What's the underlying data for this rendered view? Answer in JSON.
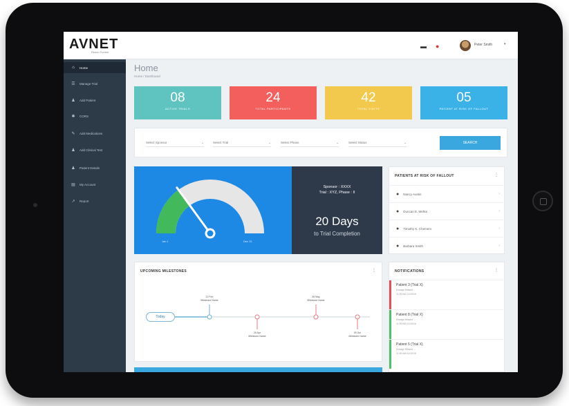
{
  "app": {
    "logo": "AVNET",
    "logo_sub": "Reach Further"
  },
  "topbar": {
    "menu_icon": "menu-icon",
    "bell_icon": "bell-icon",
    "user_name": "Peter Smith",
    "caret": "▾"
  },
  "sidebar": {
    "items": [
      {
        "label": "Home",
        "icon": "home-icon",
        "glyph": "⌂"
      },
      {
        "label": "Manage Trial",
        "icon": "clipboard-icon",
        "glyph": "☰"
      },
      {
        "label": "Add Patient",
        "icon": "user-add-icon",
        "glyph": "♟"
      },
      {
        "label": "CORS",
        "icon": "gear-icon",
        "glyph": "✱"
      },
      {
        "label": "Add Medications",
        "icon": "medication-icon",
        "glyph": "✎"
      },
      {
        "label": "Add Clinical Test",
        "icon": "user-icon",
        "glyph": "♟"
      },
      {
        "label": "Patient Details",
        "icon": "user-details-icon",
        "glyph": "♟"
      },
      {
        "label": "My Account",
        "icon": "account-icon",
        "glyph": "▤"
      },
      {
        "label": "Report",
        "icon": "report-icon",
        "glyph": "↗"
      }
    ]
  },
  "page": {
    "title": "Home",
    "breadcrumb": "Home / Dashboard"
  },
  "stats": [
    {
      "value": "08",
      "label": "ACTIVE TRIALS",
      "color": "#5fc4c0"
    },
    {
      "value": "24",
      "label": "TOTAL PARTICIPANTS",
      "color": "#f25f5c"
    },
    {
      "value": "42",
      "label": "TOTAL VISITS",
      "color": "#f2c94c"
    },
    {
      "value": "05",
      "label": "PATIENT AT RISK OF FALLOUT",
      "color": "#3ab2e8"
    }
  ],
  "filters": {
    "sponsor": "Select Sponsor",
    "trial": "Select Trial",
    "phase": "Select Phase",
    "status": "Select Status",
    "search": "SEARCH"
  },
  "gauge": {
    "start_label": "Jan 1",
    "end_label": "Dec 31",
    "progress": 0.3
  },
  "timeline": {
    "sponsor_line": "Sponsor : XXXX",
    "trial_line": "Trial : XYZ, Phase : II",
    "days": "20 Days",
    "caption": "to Trial Completion"
  },
  "risk": {
    "title": "PATIENTS AT RISK OF FALLOUT",
    "patients": [
      "Nancy Austin",
      "Duncan E. Mehta",
      "Timothy K. Chemers",
      "Barbara Smith"
    ]
  },
  "milestones": {
    "title": "UPCOMING MILESTONES",
    "today": "Today",
    "above": [
      {
        "date": "22 Feb",
        "name": "Milestone Name"
      },
      {
        "date": "28 May",
        "name": "Milestone Name"
      }
    ],
    "below": [
      {
        "date": "26 Apr",
        "name": "Milestone Name"
      },
      {
        "date": "26 Jun",
        "name": "Milestone Name"
      }
    ]
  },
  "notifications": {
    "title": "NOTIFICATIONS",
    "items": [
      {
        "title": "Patient 3 (Trial X)",
        "line1": "Dosage Missed ...",
        "line2": "11:00 AM 11/10/16",
        "color": "#e05252"
      },
      {
        "title": "Patient 8 (Trial X)",
        "line1": "Dosage Missed ...",
        "line2": "11:00 AM 11/10/16",
        "color": "#4fbf6a"
      },
      {
        "title": "Patient 5 (Trial X)",
        "line1": "Dosage Missed ...",
        "line2": "11:00 AM 11/10/16",
        "color": "#4fbf6a"
      }
    ]
  }
}
